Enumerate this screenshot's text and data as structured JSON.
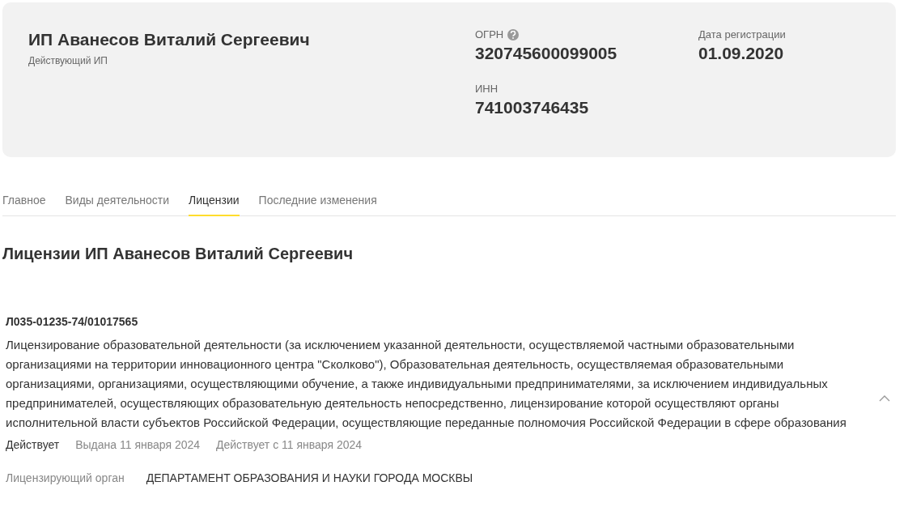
{
  "header": {
    "name": "ИП Аванесов Виталий Сергеевич",
    "status": "Действующий ИП",
    "fields": [
      {
        "label": "ОГРН",
        "value": "320745600099005",
        "help": true
      },
      {
        "label": "Дата регистрации",
        "value": "01.09.2020",
        "help": false
      },
      {
        "label": "ИНН",
        "value": "741003746435",
        "help": false
      }
    ]
  },
  "tabs": [
    {
      "label": "Главное",
      "selected": false
    },
    {
      "label": "Виды деятельности",
      "selected": false
    },
    {
      "label": "Лицензии",
      "selected": true
    },
    {
      "label": "Последние изменения",
      "selected": false
    }
  ],
  "section_title": "Лицензии ИП Аванесов Виталий Сергеевич",
  "licenses": [
    {
      "number": "Л035-01235-74/01017565",
      "expanded": true,
      "description": "Лицензирование образовательной деятельности (за исключением указанной деятельности, осуществляемой частными образовательными организациями на территории инновационного центра \"Сколково\"), Образовательная деятельность, осуществляемая образовательными организациями, организациями, осуществляющими обучение, а также индивидуальными предпринимателями, за исключением индивидуальных предпринимателей, осуществляющих образовательную деятельность непосредственно, лицензирование которой осуществляют органы исполнительной власти субъектов Российской Федерации, осуществляющие переданные полномочия Российской Федерации в сфере образования",
      "status": "Действует",
      "issued": "Выдана 11 января 2024",
      "valid_from": "Действует с 11 января 2024",
      "authority_label": "Лицензирующий орган",
      "authority": "ДЕПАРТАМЕНТ ОБРАЗОВАНИЯ И НАУКИ ГОРОДА МОСКВЫ"
    }
  ]
}
